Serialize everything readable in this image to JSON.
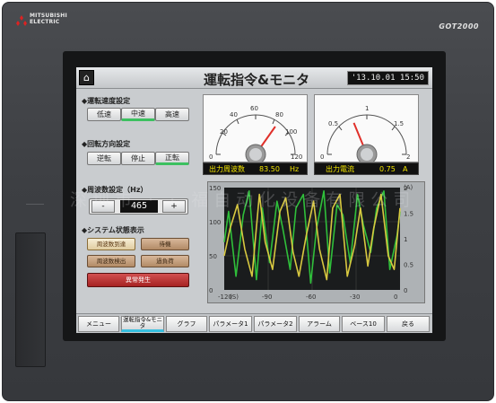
{
  "device": {
    "brand_line1": "MITSUBISHI",
    "brand_line2": "ELECTRIC",
    "model": "GOT2000"
  },
  "header": {
    "home_icon": "home-icon",
    "title": "運転指令&モニタ",
    "datetime": "'13.10.01 15:50"
  },
  "left_panel": {
    "speed_label": "◆運転速度設定",
    "speed_buttons": [
      "低速",
      "中速",
      "高速"
    ],
    "speed_selected": "中速",
    "direction_label": "◆回転方向設定",
    "direction_buttons": [
      "逆転",
      "停止",
      "正転"
    ],
    "direction_selected": "正転",
    "freq_label": "◆周波数設定（Hz）",
    "freq_minus": "-",
    "freq_value": "465",
    "freq_plus": "+",
    "status_label": "◆システム状態表示",
    "status_buttons": [
      "周波数到達",
      "待機",
      "周波数検出",
      "過負荷",
      "異常発生"
    ]
  },
  "meters": [
    {
      "ticks": [
        "20",
        "40",
        "60",
        "80",
        "100",
        "0",
        "120"
      ],
      "readout_label": "出力周波数",
      "readout_value": "83.50",
      "readout_unit": "Hz",
      "needle_value": 83.5,
      "range": [
        0,
        120
      ]
    },
    {
      "ticks": [
        "0.5",
        "1",
        "1.5",
        "0",
        "2"
      ],
      "readout_label": "出力電流",
      "readout_value": "0.75",
      "readout_unit": "A",
      "needle_value": 0.75,
      "range": [
        0,
        2
      ]
    }
  ],
  "chart_data": {
    "type": "line",
    "x_ticks": [
      "-120",
      "(S)",
      "-90",
      "-60",
      "-30",
      "0"
    ],
    "y_left_ticks": [
      "150",
      "100",
      "50",
      "0"
    ],
    "y_right_ticks": [
      "(A)",
      "2",
      "1.5",
      "1",
      "0.5",
      "0"
    ],
    "xlim": [
      -120,
      0
    ],
    "ylim_left": [
      0,
      150
    ],
    "ylim_right": [
      0,
      2
    ],
    "colors": {
      "series_green": "#2fbf3a",
      "series_yellow": "#d8c840",
      "background": "#1a1c1d"
    },
    "series": [
      {
        "x": [
          -120,
          -117,
          -112,
          -107,
          -103,
          -98,
          -94,
          -89,
          -84,
          -80,
          -75,
          -71,
          -66,
          -61,
          -57,
          -52,
          -48,
          -43,
          -39,
          -34,
          -29,
          -25,
          -20,
          -16,
          -11,
          -7,
          -2,
          0
        ],
        "values": [
          70,
          115,
          20,
          110,
          145,
          15,
          120,
          40,
          130,
          90,
          30,
          120,
          140,
          10,
          90,
          145,
          25,
          125,
          110,
          40,
          140,
          95,
          55,
          120,
          145,
          30,
          80,
          115
        ]
      },
      {
        "x": [
          -120,
          -116,
          -111,
          -106,
          -101,
          -96,
          -92,
          -87,
          -82,
          -78,
          -73,
          -69,
          -64,
          -59,
          -55,
          -50,
          -46,
          -41,
          -36,
          -31,
          -27,
          -22,
          -18,
          -13,
          -8,
          -4,
          0
        ],
        "values": [
          50,
          90,
          125,
          60,
          20,
          140,
          70,
          30,
          115,
          135,
          55,
          20,
          80,
          130,
          60,
          15,
          120,
          140,
          20,
          65,
          120,
          35,
          90,
          140,
          50,
          30,
          120
        ]
      }
    ]
  },
  "menu": {
    "items": [
      "メニュー",
      "運転指令&モニタ",
      "グラフ",
      "パラメータ1",
      "パラメータ2",
      "アラーム",
      "ベース10",
      "戻る"
    ],
    "current": "運転指令&モニタ"
  },
  "watermark": "深圳市 · · 福自动化设备有限公司"
}
